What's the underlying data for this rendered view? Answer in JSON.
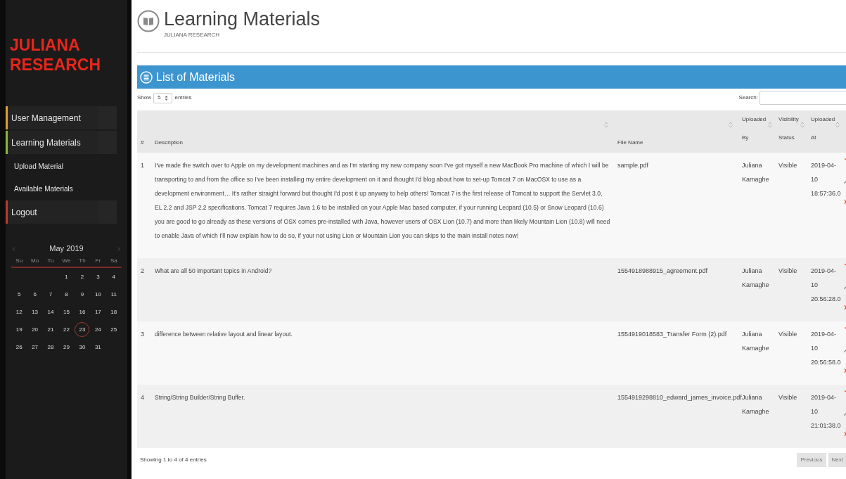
{
  "sidebar": {
    "brand": "JULIANA RESEARCH",
    "menu": [
      {
        "label": "User Management",
        "color": "#e0a030"
      },
      {
        "label": "Learning Materials",
        "color": "#8ab83a",
        "children": [
          {
            "label": "Upload Material"
          },
          {
            "label": "Available Materials"
          }
        ]
      },
      {
        "label": "Logout",
        "color": "#c0392b"
      }
    ],
    "calendar": {
      "prev": "‹",
      "month": "May 2019",
      "next": "›",
      "weekdays": [
        "Su",
        "Mo",
        "Tu",
        "We",
        "Th",
        "Fr",
        "Sa"
      ],
      "weeks": [
        [
          {
            "day": "1",
            "selected": false
          },
          {
            "day": "2",
            "selected": false
          },
          {
            "day": "3",
            "selected": false
          },
          {
            "day": "4",
            "selected": false
          }
        ],
        [
          {
            "day": "5",
            "selected": false
          },
          {
            "day": "6",
            "selected": false
          },
          {
            "day": "7",
            "selected": false
          },
          {
            "day": "8",
            "selected": false
          },
          {
            "day": "9",
            "selected": false
          },
          {
            "day": "10",
            "selected": false
          },
          {
            "day": "11",
            "selected": false
          }
        ],
        [
          {
            "day": "12",
            "selected": false
          },
          {
            "day": "13",
            "selected": false
          },
          {
            "day": "14",
            "selected": false
          },
          {
            "day": "15",
            "selected": false
          },
          {
            "day": "16",
            "selected": false
          },
          {
            "day": "17",
            "selected": false
          },
          {
            "day": "18",
            "selected": false
          }
        ],
        [
          {
            "day": "19",
            "selected": false
          },
          {
            "day": "20",
            "selected": false
          },
          {
            "day": "21",
            "selected": false
          },
          {
            "day": "22",
            "selected": false
          },
          {
            "day": "23",
            "selected": true
          },
          {
            "day": "24",
            "selected": false
          },
          {
            "day": "25",
            "selected": false
          }
        ],
        [
          {
            "day": "26",
            "selected": false
          },
          {
            "day": "27",
            "selected": false
          },
          {
            "day": "28",
            "selected": false
          },
          {
            "day": "29",
            "selected": false
          },
          {
            "day": "30",
            "selected": false
          },
          {
            "day": "31",
            "selected": false
          }
        ]
      ]
    }
  },
  "page_header": {
    "title": "Learning Materials",
    "subtitle": "JULIANA RESEARCH"
  },
  "panel": {
    "title": "List of Materials",
    "length_control": {
      "before": "Show",
      "value": "5",
      "after": "entries"
    },
    "search": {
      "label": "Search:"
    },
    "table": {
      "columns": [
        {
          "label": "#",
          "sortable": false
        },
        {
          "label": "Description",
          "sortable": true
        },
        {
          "label": "File Name",
          "sortable": true
        },
        {
          "label": "Uploaded By",
          "sortable": true
        },
        {
          "label": "Visibility Status",
          "sortable": true
        },
        {
          "label": "Uploaded At",
          "sortable": true
        }
      ],
      "rows": [
        {
          "number": "1",
          "description": "I've made the switch over to Apple on my development machines and as I'm starting my new company soon I've got myself a new MacBook Pro machine of which I will be transporting to and from the office so I've been installing my entire development on it and thought I'd blog about how to set-up Tomcat 7 on MacOSX to use as a development environment… It's rather straight forward but thought I'd post it up anyway to help others! Tomcat 7 is the first release of Tomcat to support the Servlet 3.0, EL 2.2 and JSP 2.2 specifications. Tomcat 7 requires Java 1.6 to be installed on your Apple Mac based computer, if your running Leopard (10.5) or Snow Leopard (10.6) you are good to go already as these versions of OSX comes pre-installed with Java, however users of OSX Lion (10.7) and more than likely Mountain Lion (10.8) will need to enable Java of which I'll now explain how to do so, if your not using Lion or Mountain Lion you can skips to the main install notes now!",
          "file_name": "sample.pdf",
          "uploaded_by": "Juliana Kamaghe",
          "visibility": "Visible",
          "uploaded_at": "2019-04-10 18:57:36.0"
        },
        {
          "number": "2",
          "description": "What are all 50 important topics in Android?",
          "file_name": "1554918988915_agreement.pdf",
          "uploaded_by": "Juliana Kamaghe",
          "visibility": "Visible",
          "uploaded_at": "2019-04-10 20:56:28.0"
        },
        {
          "number": "3",
          "description": "difference between relative layout and linear layout.",
          "file_name": "1554919018583_Transfer Form (2).pdf",
          "uploaded_by": "Juliana Kamaghe",
          "visibility": "Visible",
          "uploaded_at": "2019-04-10 20:56:58.0"
        },
        {
          "number": "4",
          "description": "String/String Builder/String Buffer.",
          "file_name": "1554919298810_edward_james_invoice.pdf",
          "uploaded_by": "Juliana Kamaghe",
          "visibility": "Visible",
          "uploaded_at": "2019-04-10 21:01:38.0"
        }
      ]
    },
    "info": "Showing 1 to 4 of 4 entries",
    "pagination": [
      {
        "label": "Previous",
        "disabled": true
      },
      {
        "label": "Next",
        "disabled": true
      }
    ]
  }
}
